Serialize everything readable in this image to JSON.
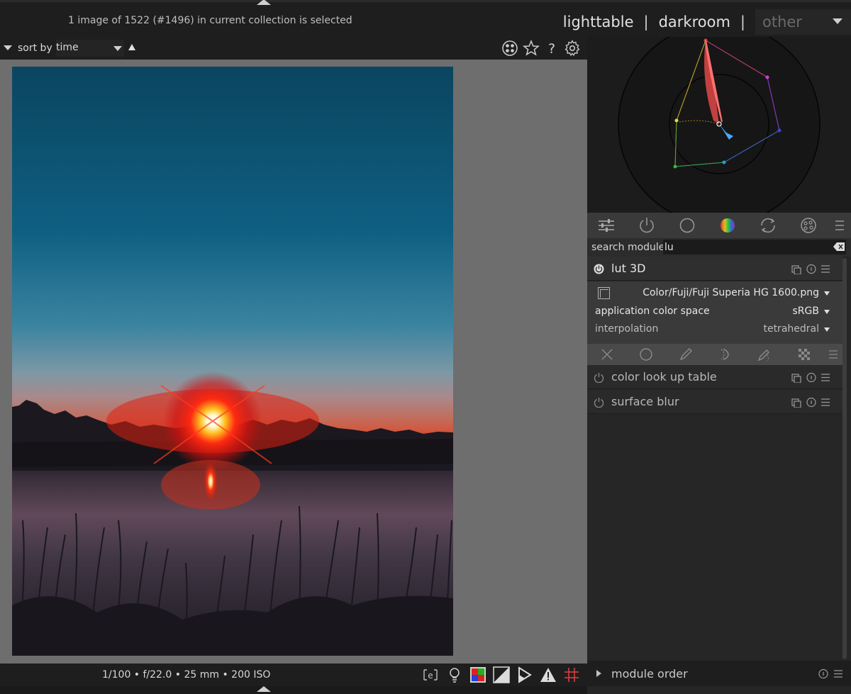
{
  "header": {
    "selection_status": "1 image of 1522 (#1496) in current collection is selected",
    "views": {
      "lighttable": "lighttable",
      "separator": "|",
      "darkroom": "darkroom",
      "other": "other"
    }
  },
  "sort_bar": {
    "label": "sort by",
    "value": "time",
    "icons": [
      "color-labels-icon",
      "star-icon",
      "help-icon",
      "gear-icon"
    ]
  },
  "bottom_bar": {
    "exif": "1/100 • f/22.0 • 25 mm • 200 ISO",
    "icons": [
      "focus-peaking-icon",
      "display-profile-icon",
      "color-assessment-icon",
      "gamut-check-icon",
      "softproof-icon",
      "overexposed-warning-icon",
      "guides-icon"
    ]
  },
  "right_panel": {
    "module_groups": [
      "quick-access-icon",
      "active-modules-icon",
      "base-group-icon",
      "color-group-icon",
      "correct-group-icon",
      "effect-group-icon",
      "presets-menu-icon"
    ],
    "search": {
      "label": "search module",
      "value": "lu"
    },
    "modules": [
      {
        "name": "lut 3D",
        "enabled": true,
        "expanded": true,
        "params": {
          "file": "Color/Fuji/Fuji Superia HG 1600.png",
          "application_color_space_label": "application color space",
          "application_color_space_value": "sRGB",
          "interpolation_label": "interpolation",
          "interpolation_value": "tetrahedral"
        }
      },
      {
        "name": "color look up table",
        "enabled": false,
        "expanded": false
      },
      {
        "name": "surface blur",
        "enabled": false,
        "expanded": false
      }
    ],
    "module_order": "module order"
  },
  "colors": {
    "accent": "#e0e0e0",
    "panel_bg": "#262626",
    "center_bg": "#6e6e6e",
    "vectorscope_trace": "#e05050",
    "vectorscope_highlight": "#3aa0ff"
  }
}
